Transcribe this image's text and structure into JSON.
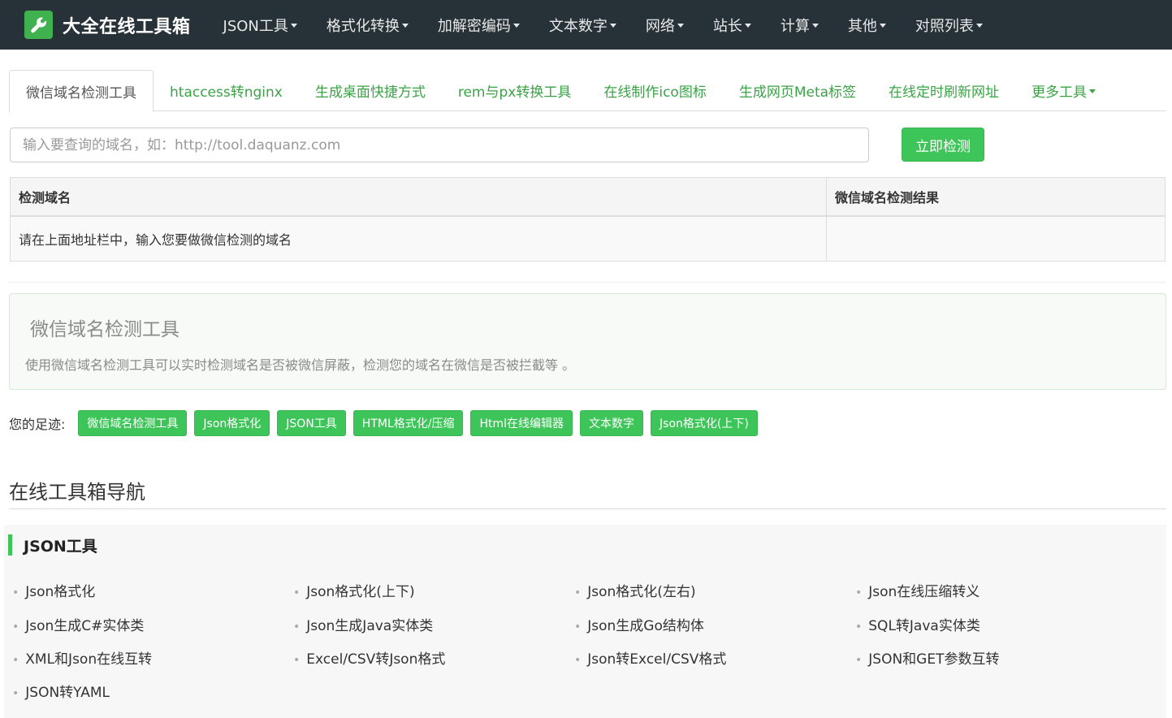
{
  "navbar": {
    "brand": "大全在线工具箱",
    "items": [
      {
        "label": "JSON工具"
      },
      {
        "label": "格式化转换"
      },
      {
        "label": "加解密编码"
      },
      {
        "label": "文本数字"
      },
      {
        "label": "网络"
      },
      {
        "label": "站长"
      },
      {
        "label": "计算"
      },
      {
        "label": "其他"
      },
      {
        "label": "对照列表"
      }
    ]
  },
  "tabs": [
    {
      "label": "微信域名检测工具"
    },
    {
      "label": "htaccess转nginx"
    },
    {
      "label": "生成桌面快捷方式"
    },
    {
      "label": "rem与px转换工具"
    },
    {
      "label": "在线制作ico图标"
    },
    {
      "label": "生成网页Meta标签"
    },
    {
      "label": "在线定时刷新网址"
    },
    {
      "label": "更多工具"
    }
  ],
  "search": {
    "placeholder": "输入要查询的域名，如：http://tool.daquanz.com",
    "value": "",
    "button": "立即检测"
  },
  "table": {
    "headers": [
      "检测域名",
      "微信域名检测结果"
    ],
    "row": [
      "请在上面地址栏中，输入您要做微信检测的域名",
      ""
    ]
  },
  "info": {
    "title": "微信域名检测工具",
    "description": "使用微信域名检测工具可以实时检测域名是否被微信屏蔽，检测您的域名在微信是否被拦截等 。"
  },
  "footprint": {
    "label": "您的足迹:",
    "tags": [
      "微信域名检测工具",
      "Json格式化",
      "JSON工具",
      "HTML格式化/压缩",
      "Html在线编辑器",
      "文本数字",
      "Json格式化(上下)"
    ]
  },
  "nav_heading": "在线工具箱导航",
  "category": {
    "title": "JSON工具",
    "items": [
      "Json格式化",
      "Json格式化(上下)",
      "Json格式化(左右)",
      "Json在线压缩转义",
      "Json生成C#实体类",
      "Json生成Java实体类",
      "Json生成Go结构体",
      "SQL转Java实体类",
      "XML和Json在线互转",
      "Excel/CSV转Json格式",
      "Json转Excel/CSV格式",
      "JSON和GET参数互转",
      "JSON转YAML"
    ]
  },
  "colors": {
    "navbar": "#263238",
    "accent": "#3ec559",
    "link": "#3aa346"
  },
  "icons": {
    "brand": "wrench-icon",
    "dropdown": "caret-down-icon"
  }
}
